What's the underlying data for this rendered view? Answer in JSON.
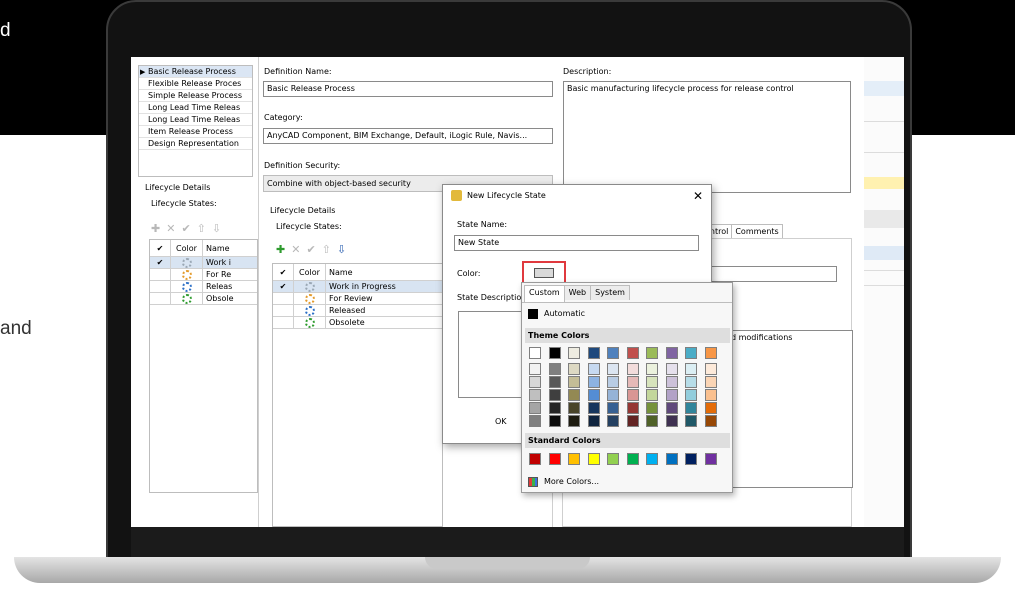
{
  "side_text": {
    "line1": "d",
    "line2": "and"
  },
  "process_list": {
    "items": [
      "Basic Release Process",
      "Flexible Release Proces",
      "Simple Release Process",
      "Long Lead Time Releas",
      "Long Lead Time Releas",
      "Item Release Process",
      "Design Representation"
    ],
    "selected_index": 0
  },
  "left_details": {
    "heading": "Lifecycle Details",
    "states_label": "Lifecycle States:",
    "grid_header": {
      "check": "✔",
      "color": "Color",
      "name": "Name"
    },
    "rows": [
      {
        "check": "✔",
        "icon": "grey",
        "name": "Work i"
      },
      {
        "check": "",
        "icon": "orange",
        "name": "For Re"
      },
      {
        "check": "",
        "icon": "blue",
        "name": "Releas"
      },
      {
        "check": "",
        "icon": "green",
        "name": "Obsole"
      }
    ]
  },
  "definition": {
    "name_label": "Definition Name:",
    "name_value": "Basic Release Process",
    "category_label": "Category:",
    "category_value": "AnyCAD Component, BIM Exchange, Default, iLogic Rule, Navis...",
    "security_label": "Definition Security:",
    "security_value": "Combine with object-based security",
    "description_label": "Description:",
    "description_value": "Basic manufacturing lifecycle process for release control"
  },
  "middle_details": {
    "heading": "Lifecycle Details",
    "states_label": "Lifecycle States:",
    "grid_header": {
      "check": "✔",
      "color": "Color",
      "name": "Name"
    },
    "rows": [
      {
        "check": "✔",
        "icon": "grey",
        "name": "Work in Progress"
      },
      {
        "check": "",
        "icon": "orange",
        "name": "For Review"
      },
      {
        "check": "",
        "icon": "blue",
        "name": "Released"
      },
      {
        "check": "",
        "icon": "green",
        "name": "Obsolete"
      }
    ]
  },
  "right_tabs": {
    "control": "ontrol",
    "comments": "Comments"
  },
  "right_partial_text": "d modifications",
  "dialog": {
    "title": "New Lifecycle State",
    "close": "✕",
    "state_name_label": "State Name:",
    "state_name_value": "New State",
    "color_label": "Color:",
    "state_desc_label": "State Descriptio",
    "ok": "OK"
  },
  "color_popup": {
    "tabs": [
      "Custom",
      "Web",
      "System"
    ],
    "active_tab": "Custom",
    "automatic": "Automatic",
    "theme_colors_label": "Theme Colors",
    "theme_base": [
      "#ffffff",
      "#000000",
      "#eeece1",
      "#1f497d",
      "#4f81bd",
      "#c0504d",
      "#9bbb59",
      "#8064a2",
      "#4bacc6",
      "#f79646"
    ],
    "theme_shades": [
      [
        "#f2f2f2",
        "#7f7f7f",
        "#ddd9c3",
        "#c6d9f0",
        "#dbe5f1",
        "#f2dcdb",
        "#ebf1dd",
        "#e5e0ec",
        "#dbeef3",
        "#fdeada"
      ],
      [
        "#d8d8d8",
        "#595959",
        "#c4bd97",
        "#8db3e2",
        "#b8cce4",
        "#e5b9b7",
        "#d7e3bc",
        "#ccc1d9",
        "#b7dde8",
        "#fbd5b5"
      ],
      [
        "#bfbfbf",
        "#3f3f3f",
        "#938953",
        "#548dd4",
        "#95b3d7",
        "#d99694",
        "#c3d69b",
        "#b2a2c7",
        "#92cddc",
        "#fac08f"
      ],
      [
        "#a5a5a5",
        "#262626",
        "#494429",
        "#17365d",
        "#366092",
        "#953734",
        "#76923c",
        "#5f497a",
        "#31859b",
        "#e36c09"
      ],
      [
        "#7f7f7f",
        "#0c0c0c",
        "#1d1b10",
        "#0f243e",
        "#244061",
        "#632423",
        "#4f6128",
        "#3f3151",
        "#205867",
        "#974806"
      ]
    ],
    "standard_colors_label": "Standard Colors",
    "standard": [
      "#c00000",
      "#ff0000",
      "#ffc000",
      "#ffff00",
      "#92d050",
      "#00b050",
      "#00b0f0",
      "#0070c0",
      "#002060",
      "#7030a0"
    ],
    "more_colors": "More Colors..."
  }
}
